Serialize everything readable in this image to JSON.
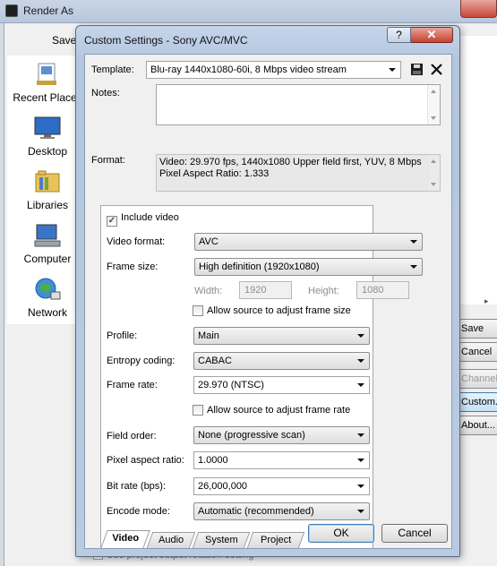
{
  "background_window": {
    "title": "Render As",
    "save_label": "Save",
    "places": [
      "Recent Places",
      "Desktop",
      "Libraries",
      "Computer",
      "Network"
    ],
    "buttons": [
      "Save",
      "Cancel",
      "Channels...",
      "Custom...",
      "About..."
    ],
    "rotation_checkbox": "Use project output rotation setting"
  },
  "dialog": {
    "title": "Custom Settings - Sony AVC/MVC",
    "help_label": "?",
    "close_label": "✕",
    "template_label": "Template:",
    "template_value": "Blu-ray 1440x1080-60i, 8 Mbps video stream",
    "notes_label": "Notes:",
    "notes_value": "",
    "format_label": "Format:",
    "format_line1": "Video: 29.970 fps, 1440x1080 Upper field first, YUV, 8 Mbps",
    "format_line2": "Pixel Aspect Ratio: 1.333",
    "include_video": {
      "label": "Include video",
      "checked": true
    },
    "video_format": {
      "label": "Video format:",
      "value": "AVC"
    },
    "frame_size": {
      "label": "Frame size:",
      "value": "High definition (1920x1080)"
    },
    "width": {
      "label": "Width:",
      "value": "1920"
    },
    "height": {
      "label": "Height:",
      "value": "1080"
    },
    "allow_frame_size": {
      "label": "Allow source to adjust frame size",
      "checked": false
    },
    "profile": {
      "label": "Profile:",
      "value": "Main"
    },
    "entropy_coding": {
      "label": "Entropy coding:",
      "value": "CABAC"
    },
    "frame_rate": {
      "label": "Frame rate:",
      "value": "29.970 (NTSC)"
    },
    "allow_frame_rate": {
      "label": "Allow source to adjust frame rate",
      "checked": false
    },
    "field_order": {
      "label": "Field order:",
      "value": "None (progressive scan)"
    },
    "pixel_aspect": {
      "label": "Pixel aspect ratio:",
      "value": "1.0000"
    },
    "bit_rate": {
      "label": "Bit rate (bps):",
      "value": "26,000,000"
    },
    "encode_mode": {
      "label": "Encode mode:",
      "value": "Automatic (recommended)"
    },
    "tabs": [
      "Video",
      "Audio",
      "System",
      "Project"
    ],
    "active_tab": "Video",
    "ok_label": "OK",
    "cancel_label": "Cancel"
  },
  "colors": {
    "dialog_frame": "#b9cbe2",
    "close_red": "#c6402f",
    "default_button_border": "#3b7cb5"
  }
}
